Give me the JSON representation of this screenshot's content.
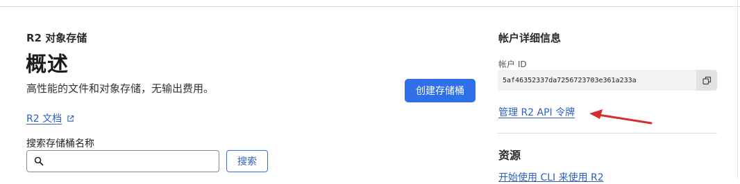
{
  "header": {
    "section": "R2 对象存储",
    "title": "概述",
    "subtitle": "高性能的文件和对象存储，无输出费用。"
  },
  "actions": {
    "create_bucket": "创建存储桶"
  },
  "docs": {
    "link": "R2 文档",
    "icon": "external-link-icon"
  },
  "search": {
    "label": "搜索存储桶名称",
    "value": "",
    "placeholder": "",
    "button": "搜索",
    "icon": "search-icon"
  },
  "account": {
    "heading": "帐户详细信息",
    "id_label": "帐户 ID",
    "id_value": "5af46352337da7256723703e361a233a",
    "copy_icon": "copy-icon",
    "manage_tokens": "管理 R2 API 令牌"
  },
  "annotation": {
    "icon": "red-arrow-icon",
    "color": "#d62d2d"
  },
  "resources": {
    "heading": "资源",
    "link": "开始使用 CLI 来使用 R2"
  },
  "colors": {
    "primary": "#2f6fe8",
    "link": "#2f5fbf"
  }
}
